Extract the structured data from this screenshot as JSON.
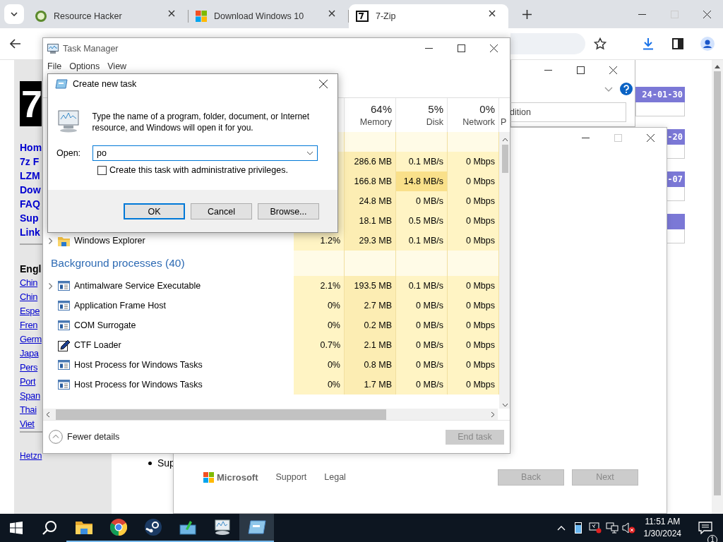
{
  "browser": {
    "tabs": [
      {
        "title": "Resource Hacker",
        "selected": false,
        "kind": "badge"
      },
      {
        "title": "Download Windows 10",
        "selected": false,
        "kind": "tiles"
      },
      {
        "title": "7-Zip",
        "selected": true,
        "kind": "sevenzip"
      }
    ]
  },
  "site": {
    "logo": "7",
    "nav": [
      "Hom",
      "7z F",
      "LZM",
      "Dow",
      "FAQ",
      "Sup",
      "Link"
    ],
    "language_heading": "Engl",
    "languages": [
      "Chin",
      "Chin",
      "Espe",
      "Fren",
      "Germ",
      "Japa",
      "Pers",
      "Port",
      "Span",
      "Thai",
      "Viet"
    ],
    "footer_link": "Hetzn",
    "bullet": "Sup",
    "dates": [
      "24-01-30",
      "-20",
      "-07"
    ]
  },
  "setup": {
    "edition_field": "dition",
    "brand": "Microsoft",
    "footer_links": [
      "Support",
      "Legal"
    ],
    "buttons": [
      {
        "label": "Back",
        "disabled": true
      },
      {
        "label": "Next",
        "disabled": true
      }
    ]
  },
  "task_manager": {
    "title": "Task Manager",
    "menu": [
      "File",
      "Options",
      "View"
    ],
    "columns": [
      {
        "percent": "64%",
        "label": "Memory"
      },
      {
        "percent": "5%",
        "label": "Disk"
      },
      {
        "percent": "0%",
        "label": "Network"
      },
      {
        "label": "P"
      }
    ],
    "rows": [
      {
        "kind": "covered",
        "memory": "286.6 MB",
        "disk": "0.1 MB/s",
        "network": "0 Mbps"
      },
      {
        "kind": "covered",
        "memory": "166.8 MB",
        "disk": "14.8 MB/s",
        "network": "0 Mbps"
      },
      {
        "kind": "covered",
        "memory": "24.8 MB",
        "disk": "0 MB/s",
        "network": "0 Mbps"
      },
      {
        "kind": "covered",
        "memory": "18.1 MB",
        "disk": "0.5 MB/s",
        "network": "0 Mbps"
      },
      {
        "kind": "explorer",
        "name": "Windows Explorer",
        "expandable": true,
        "cpu": "1.2%",
        "memory": "29.3 MB",
        "disk": "0.1 MB/s",
        "network": "0 Mbps"
      },
      {
        "kind": "group",
        "title": "Background processes (40)"
      },
      {
        "kind": "service",
        "name": "Antimalware Service Executable",
        "expandable": true,
        "cpu": "2.1%",
        "memory": "193.5 MB",
        "disk": "0.1 MB/s",
        "network": "0 Mbps"
      },
      {
        "kind": "service",
        "name": "Application Frame Host",
        "expandable": false,
        "cpu": "0%",
        "memory": "2.7 MB",
        "disk": "0 MB/s",
        "network": "0 Mbps"
      },
      {
        "kind": "service",
        "name": "COM Surrogate",
        "expandable": false,
        "cpu": "0%",
        "memory": "0.2 MB",
        "disk": "0 MB/s",
        "network": "0 Mbps"
      },
      {
        "kind": "editor",
        "name": "CTF Loader",
        "expandable": false,
        "cpu": "0.7%",
        "memory": "2.1 MB",
        "disk": "0 MB/s",
        "network": "0 Mbps"
      },
      {
        "kind": "service",
        "name": "Host Process for Windows Tasks",
        "expandable": false,
        "cpu": "0%",
        "memory": "0.8 MB",
        "disk": "0 MB/s",
        "network": "0 Mbps"
      },
      {
        "kind": "service",
        "name": "Host Process for Windows Tasks",
        "expandable": false,
        "cpu": "0%",
        "memory": "1.7 MB",
        "disk": "0 MB/s",
        "network": "0 Mbps"
      }
    ],
    "details_toggle": "Fewer details",
    "end_task": {
      "label": "End task",
      "disabled": true
    }
  },
  "run_dialog": {
    "title": "Create new task",
    "description": "Type the name of a program, folder, document, or Internet resource, and Windows will open it for you.",
    "open_label": "Open:",
    "value": "po",
    "admin_checkbox": {
      "label": "Create this task with administrative privileges.",
      "checked": false
    },
    "buttons": [
      "OK",
      "Cancel",
      "Browse..."
    ]
  },
  "taskbar": {
    "apps": [
      {
        "kind": "explorer",
        "running": true,
        "selected": false
      },
      {
        "kind": "chrome",
        "running": true,
        "selected": false
      },
      {
        "kind": "steam",
        "running": true,
        "selected": false
      },
      {
        "kind": "installer",
        "running": true,
        "selected": false
      },
      {
        "kind": "monitor",
        "running": true,
        "selected": false
      },
      {
        "kind": "run",
        "running": true,
        "selected": true
      }
    ],
    "time": "11:51 AM",
    "date": "1/30/2024",
    "notifications": "1"
  }
}
